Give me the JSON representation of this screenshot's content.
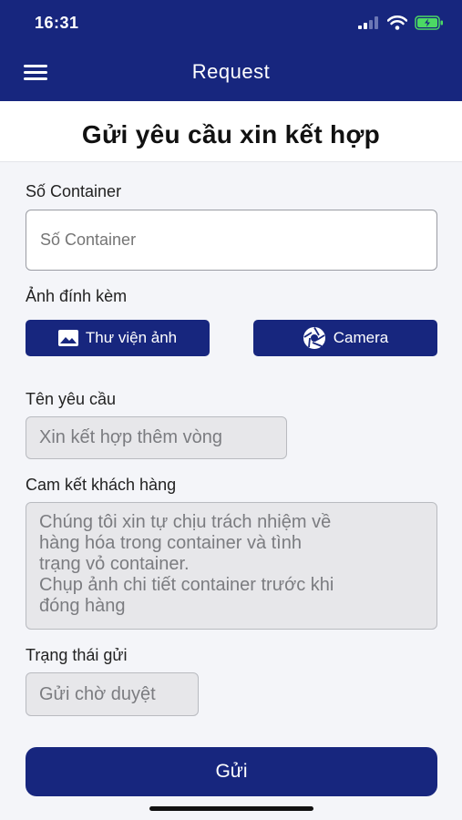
{
  "status_bar": {
    "time": "16:31"
  },
  "header": {
    "title": "Request",
    "menu_icon": "hamburger-menu-icon"
  },
  "page_title": "Gửi yêu cầu xin kết hợp",
  "container": {
    "label": "Số Container",
    "placeholder": "Số Container",
    "value": ""
  },
  "attachments": {
    "label": "Ảnh đính kèm",
    "library_button": "Thư viện ảnh",
    "library_icon": "image-icon",
    "camera_button": "Camera",
    "camera_icon": "camera-aperture-icon"
  },
  "request_name": {
    "label": "Tên yêu cầu",
    "value": "Xin kết hợp thêm vòng"
  },
  "commitment": {
    "label": "Cam kết khách hàng",
    "lines": [
      "Chúng tôi xin tự chịu trách nhiệm về",
      "hàng hóa trong container và tình",
      "trạng vỏ container.",
      "Chụp ảnh chi tiết container trước khi",
      "đóng hàng"
    ]
  },
  "send_status": {
    "label": "Trạng thái gửi",
    "value": "Gửi chờ duyệt"
  },
  "submit_label": "Gửi",
  "colors": {
    "primary": "#17267e",
    "background": "#f4f5f9",
    "readonly_bg": "#e7e7ea"
  }
}
